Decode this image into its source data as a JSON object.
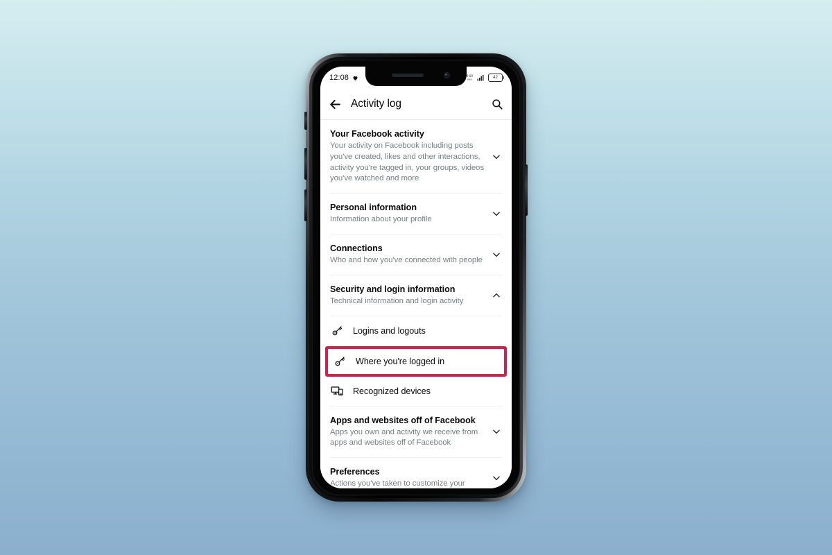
{
  "background": {
    "gradient_top": "#d5eef0",
    "gradient_bottom": "#8bb0ce"
  },
  "device": {
    "type": "smartphone-mockup",
    "frame_color": "#050506"
  },
  "status_bar": {
    "time": "12:08",
    "left_icons": [
      "heart-icon"
    ],
    "right_icons": [
      "location-icon",
      "network-speed-icon",
      "signal-bars-icon",
      "battery-icon"
    ],
    "battery_level": "42"
  },
  "header": {
    "back_icon": "arrow-left-icon",
    "title": "Activity log",
    "search_icon": "search-icon"
  },
  "sections": [
    {
      "title": "Your Facebook activity",
      "subtitle": "Your activity on Facebook including posts you've created, likes and other interactions, activity you're tagged in, your groups, videos you've watched and more",
      "chevron": "chevron-down-icon",
      "expanded": false
    },
    {
      "title": "Personal information",
      "subtitle": "Information about your profile",
      "chevron": "chevron-down-icon",
      "expanded": false
    },
    {
      "title": "Connections",
      "subtitle": "Who and how you've connected with people",
      "chevron": "chevron-down-icon",
      "expanded": false
    },
    {
      "title": "Security and login information",
      "subtitle": "Technical information and login activity",
      "chevron": "chevron-up-icon",
      "expanded": true
    }
  ],
  "security_subitems": [
    {
      "label": "Logins and logouts",
      "icon": "key-icon",
      "highlighted": false
    },
    {
      "label": "Where you're logged in",
      "icon": "key-icon",
      "highlighted": true
    },
    {
      "label": "Recognized devices",
      "icon": "devices-icon",
      "highlighted": false
    }
  ],
  "bottom_sections": [
    {
      "title": "Apps and websites off of Facebook",
      "subtitle": "Apps you own and activity we receive from apps and websites off of Facebook",
      "chevron": "chevron-down-icon"
    },
    {
      "title": "Preferences",
      "subtitle": "Actions you've taken to customize your",
      "chevron": "chevron-down-icon"
    }
  ],
  "highlight": {
    "color": "#d6204a",
    "target_label": "Where you're logged in"
  }
}
